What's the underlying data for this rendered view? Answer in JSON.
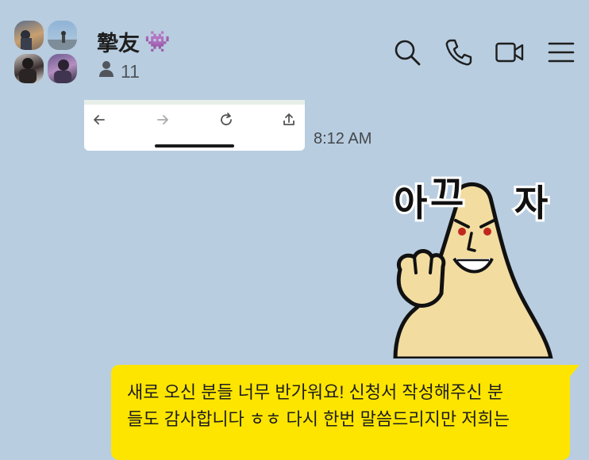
{
  "header": {
    "title": "摯友",
    "title_emoji": "👾",
    "member_count": "11",
    "icons": [
      "search-icon",
      "phone-icon",
      "video-icon",
      "menu-icon"
    ]
  },
  "messages": [
    {
      "type": "image",
      "time": "8:12 AM"
    },
    {
      "type": "sticker",
      "text": "아끄자"
    },
    {
      "type": "text",
      "line1": "새로 오신 분들 너무 반가워요! 신청서 작성해주신 분",
      "line2": "들도 감사합니다 ㅎㅎ 다시 한번 말씀드리지만 저희는"
    }
  ],
  "colors": {
    "background": "#b8cde0",
    "bubble": "#fee500",
    "icon": "#1e1e1e"
  }
}
